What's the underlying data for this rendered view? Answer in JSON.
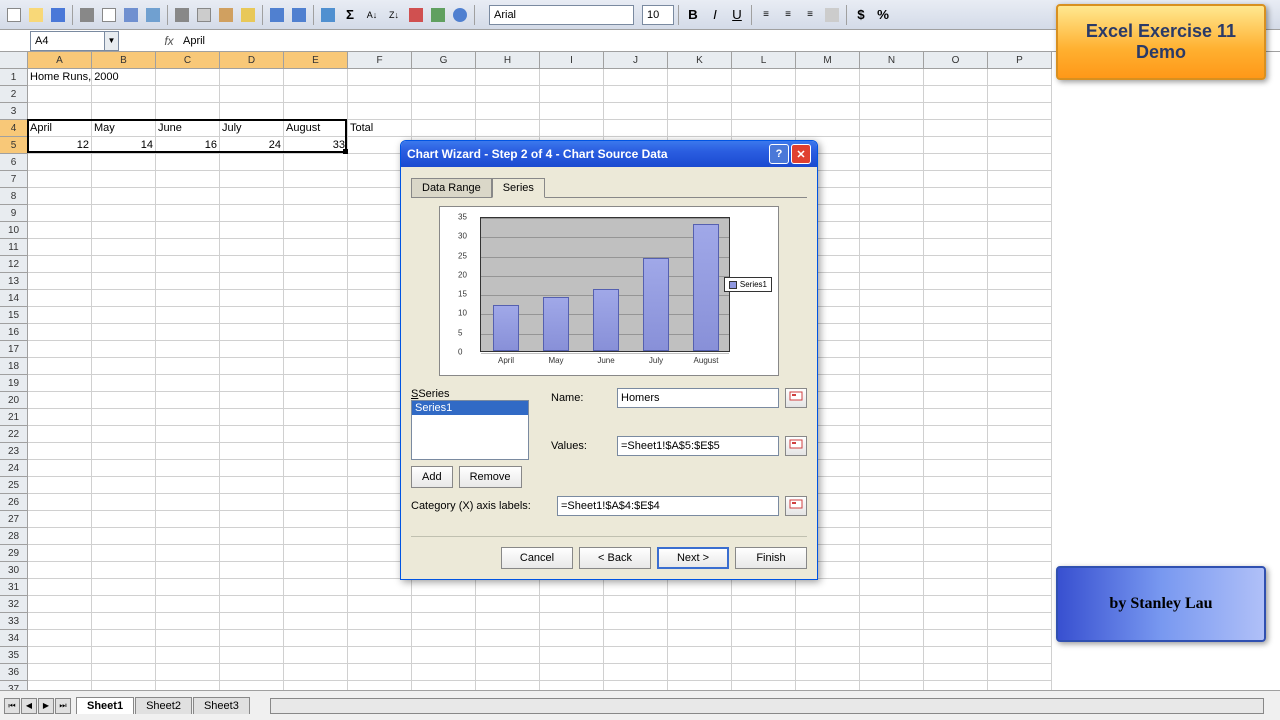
{
  "toolbar": {
    "font": "Arial",
    "size": "10"
  },
  "namebox": "A4",
  "formula": "April",
  "columns": [
    "A",
    "B",
    "C",
    "D",
    "E",
    "F",
    "G",
    "H",
    "I",
    "J",
    "K",
    "L",
    "M",
    "N",
    "O",
    "P"
  ],
  "rows": 37,
  "cells": {
    "r1": {
      "A": "Home Runs, 2000"
    },
    "r4": {
      "A": "April",
      "B": "May",
      "C": "June",
      "D": "July",
      "E": "August",
      "F": "Total"
    },
    "r5": {
      "A": "12",
      "B": "14",
      "C": "16",
      "D": "24",
      "E": "33"
    }
  },
  "selection": {
    "row1": 4,
    "col1": 0,
    "row2": 5,
    "col2": 4
  },
  "sheets": [
    "Sheet1",
    "Sheet2",
    "Sheet3"
  ],
  "active_sheet": 0,
  "dialog": {
    "title": "Chart Wizard - Step 2 of 4 - Chart Source Data",
    "tabs": [
      "Data Range",
      "Series"
    ],
    "active_tab": 1,
    "series_label": "Series",
    "series_items": [
      "Series1"
    ],
    "add": "Add",
    "remove": "Remove",
    "name_lbl": "Name:",
    "name_val": "Homers",
    "values_lbl": "Values:",
    "values_val": "=Sheet1!$A$5:$E$5",
    "cat_lbl": "Category (X) axis labels:",
    "cat_val": "=Sheet1!$A$4:$E$4",
    "cancel": "Cancel",
    "back": "< Back",
    "next": "Next >",
    "finish": "Finish",
    "legend": "Series1"
  },
  "chart_data": {
    "type": "bar",
    "categories": [
      "April",
      "May",
      "June",
      "July",
      "August"
    ],
    "values": [
      12,
      14,
      16,
      24,
      33
    ],
    "ylim": [
      0,
      35
    ],
    "yticks": [
      0,
      5,
      10,
      15,
      20,
      25,
      30,
      35
    ],
    "series_name": "Series1"
  },
  "banner_top_l1": "Excel Exercise 11",
  "banner_top_l2": "Demo",
  "banner_bot": "by Stanley Lau"
}
